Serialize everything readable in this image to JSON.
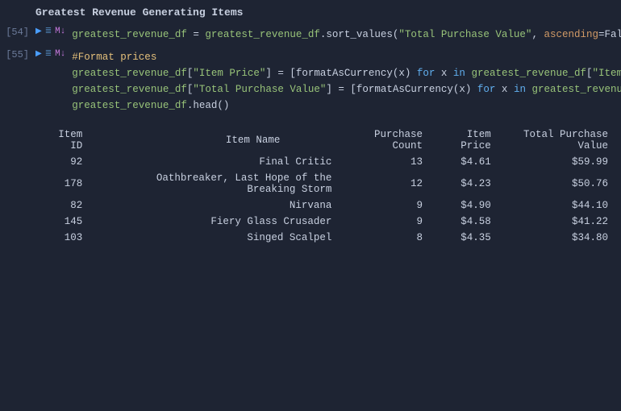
{
  "title": "Greatest Revenue Generating Items",
  "cells": [
    {
      "number": "[54]",
      "code_lines": [
        {
          "parts": [
            {
              "text": "greatest_revenue_df = greatest_revenue_df.sort_values(",
              "class": ""
            },
            {
              "text": "\"Total Purchase Value\"",
              "class": "kw-string"
            },
            {
              "text": ", ",
              "class": ""
            },
            {
              "text": "ascending",
              "class": "kw-param"
            },
            {
              "text": "=Fal",
              "class": ""
            }
          ]
        }
      ]
    },
    {
      "number": "[55]",
      "code_lines": [
        {
          "text": "#Format prices",
          "class": "kw-comment"
        },
        {
          "parts": [
            {
              "text": "greatest_revenue_df[",
              "class": ""
            },
            {
              "text": "\"Item Price\"",
              "class": "kw-string"
            },
            {
              "text": "] = [formatAsCurrency(x) ",
              "class": ""
            },
            {
              "text": "for",
              "class": "kw-blue"
            },
            {
              "text": " x ",
              "class": ""
            },
            {
              "text": "in",
              "class": "kw-blue"
            },
            {
              "text": " greatest_revenue_df[",
              "class": ""
            },
            {
              "text": "\"Item",
              "class": "kw-string"
            }
          ]
        },
        {
          "parts": [
            {
              "text": "greatest_revenue_df[",
              "class": ""
            },
            {
              "text": "\"Total Purchase Value\"",
              "class": "kw-string"
            },
            {
              "text": "] = [formatAsCurrency(x) ",
              "class": ""
            },
            {
              "text": "for",
              "class": "kw-blue"
            },
            {
              "text": " x ",
              "class": ""
            },
            {
              "text": "in",
              "class": "kw-blue"
            },
            {
              "text": " greatest_revenu",
              "class": ""
            }
          ]
        },
        {
          "text": "greatest_revenue_df.head()",
          "class": ""
        }
      ]
    }
  ],
  "table": {
    "headers": [
      "Item ID",
      "Item Name",
      "Purchase Count",
      "Item Price",
      "Total Purchase Value"
    ],
    "rows": [
      {
        "id": "92",
        "name": "Final Critic",
        "count": "13",
        "price": "$4.61",
        "total": "$59.99"
      },
      {
        "id": "178",
        "name": "Oathbreaker, Last Hope of the Breaking Storm",
        "count": "12",
        "price": "$4.23",
        "total": "$50.76"
      },
      {
        "id": "82",
        "name": "Nirvana",
        "count": "9",
        "price": "$4.90",
        "total": "$44.10"
      },
      {
        "id": "145",
        "name": "Fiery Glass Crusader",
        "count": "9",
        "price": "$4.58",
        "total": "$41.22"
      },
      {
        "id": "103",
        "name": "Singed Scalpel",
        "count": "8",
        "price": "$4.35",
        "total": "$34.80"
      }
    ]
  }
}
